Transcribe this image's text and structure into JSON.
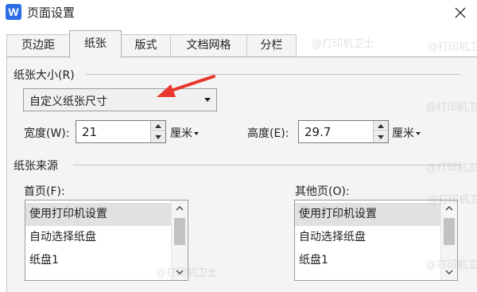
{
  "window": {
    "app_icon_letter": "W",
    "title": "页面设置"
  },
  "tabs": [
    {
      "label": "页边距"
    },
    {
      "label": "纸张"
    },
    {
      "label": "版式"
    },
    {
      "label": "文档网格"
    },
    {
      "label": "分栏"
    }
  ],
  "active_tab": "纸张",
  "paper_size": {
    "section_label": "纸张大小(R)",
    "selected": "自定义纸张尺寸",
    "width_label": "宽度(W):",
    "width_value": "21",
    "height_label": "高度(E):",
    "height_value": "29.7",
    "unit": "厘米"
  },
  "paper_source": {
    "section_label": "纸张来源",
    "first_page": {
      "label": "首页(F):",
      "items": [
        "使用打印机设置",
        "自动选择纸盘",
        "纸盘1"
      ],
      "selected_index": 0
    },
    "other_pages": {
      "label": "其他页(O):",
      "items": [
        "使用打印机设置",
        "自动选择纸盘",
        "纸盘1"
      ],
      "selected_index": 0
    }
  },
  "annotation": {
    "arrow_color": "#e8382d"
  },
  "watermark": "@打印机卫士",
  "colors": {
    "app_icon": "#2b6de6",
    "arrow": "#e8382d"
  }
}
